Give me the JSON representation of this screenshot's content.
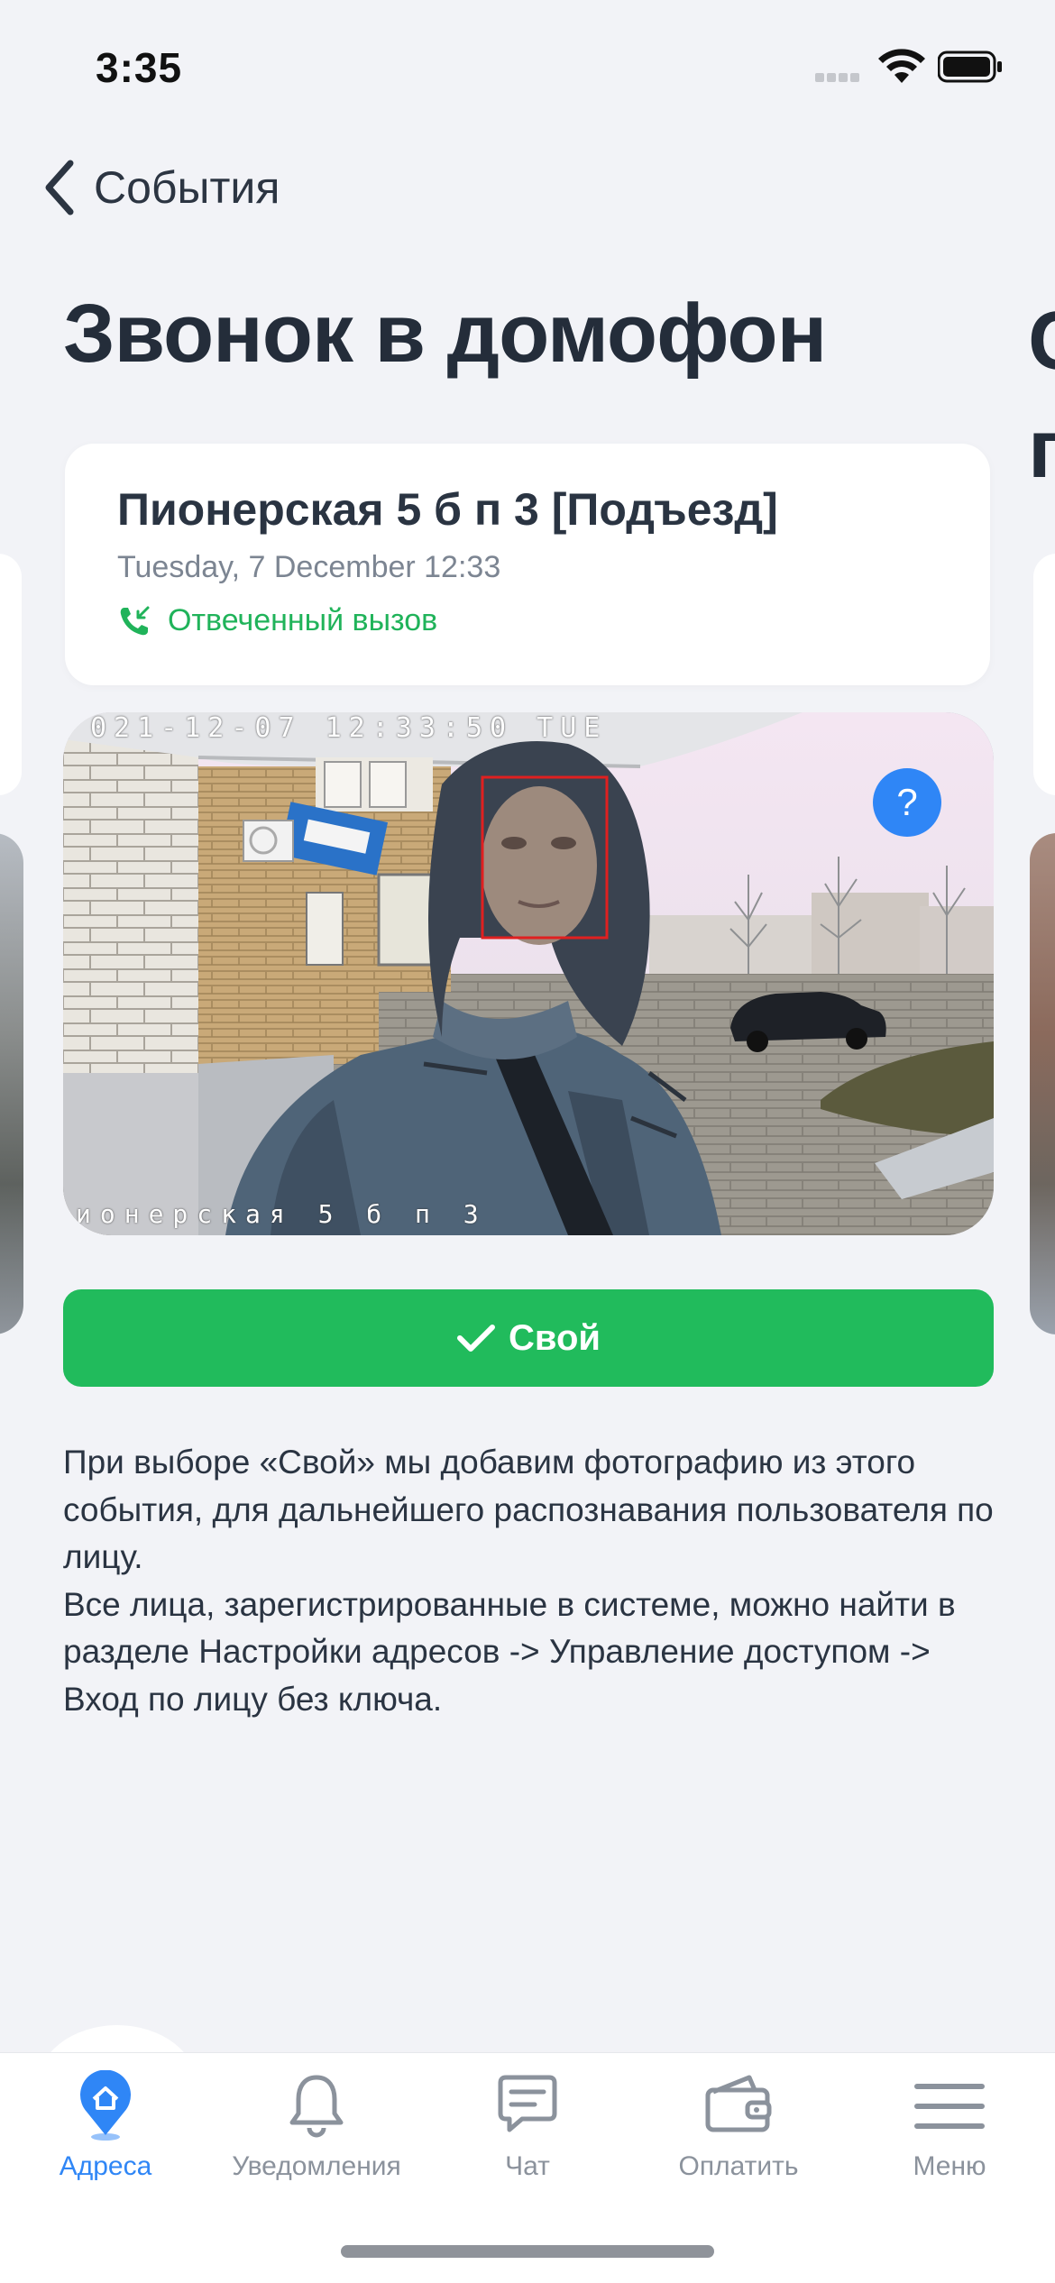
{
  "status_bar": {
    "time": "3:35"
  },
  "nav": {
    "back_label": "События"
  },
  "page": {
    "title": "Звонок в домофон",
    "next_title_peek": "С\nп"
  },
  "event_card": {
    "address": "Пионерская 5 б п 3 [Подъезд]",
    "datetime": "Tuesday, 7 December 12:33",
    "status": "Отвеченный вызов"
  },
  "camera": {
    "timestamp_overlay": "021-12-07 12:33:50 TUE",
    "caption_overlay": "ионерская 5 б п 3",
    "help_label": "?"
  },
  "action": {
    "own_label": "Свой"
  },
  "description": {
    "line1": "При выборе «Свой» мы добавим фотографию из этого события, для дальнейшего распознавания пользователя по лицу.",
    "line2": "Все лица, зарегистрированные в системе, можно найти в разделе Настройки адресов -> Управление доступом -> Вход по лицу без ключа."
  },
  "tab_bar": {
    "tabs": [
      {
        "label": "Адреса",
        "icon": "location-home-icon",
        "active": true
      },
      {
        "label": "Уведомления",
        "icon": "bell-icon",
        "active": false
      },
      {
        "label": "Чат",
        "icon": "chat-icon",
        "active": false
      },
      {
        "label": "Оплатить",
        "icon": "wallet-icon",
        "active": false
      },
      {
        "label": "Меню",
        "icon": "menu-icon",
        "active": false
      }
    ]
  },
  "colors": {
    "accent_blue": "#2f86f6",
    "accent_green": "#21bb5c",
    "status_green": "#20b35a",
    "background": "#f2f3f7",
    "face_box": "#e02020"
  }
}
